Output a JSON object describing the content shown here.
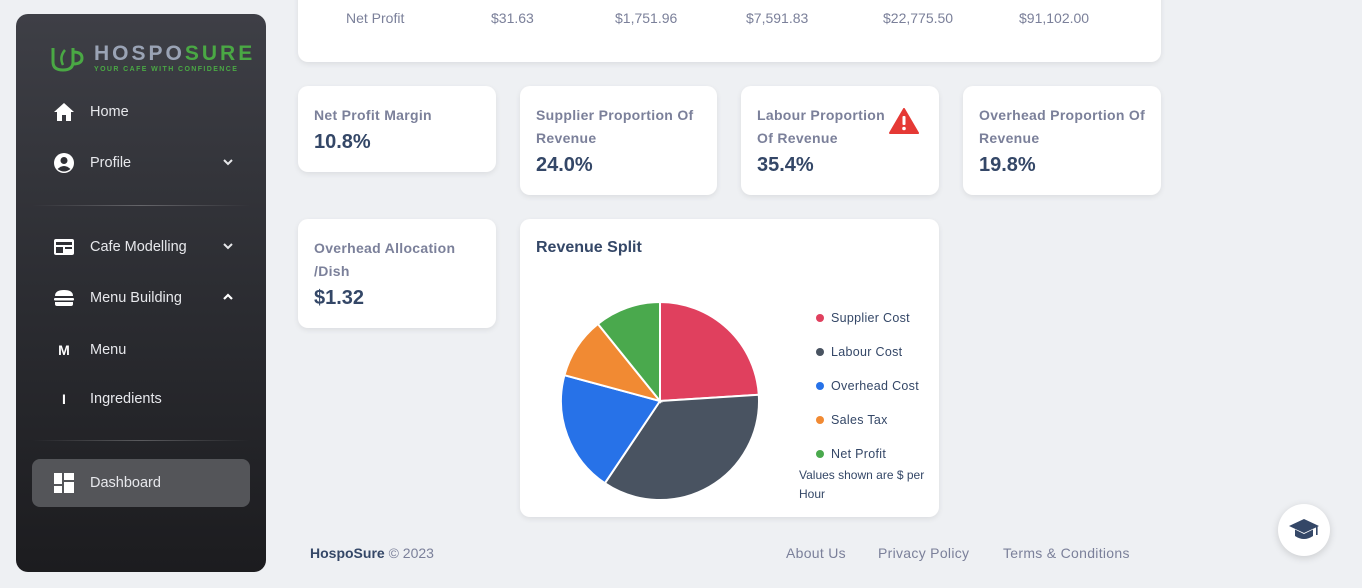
{
  "brand": {
    "name_part1": "HOSPO",
    "name_part2": "SURE",
    "tagline": "YOUR CAFE WITH CONFIDENCE"
  },
  "sidebar": {
    "items": [
      {
        "label": "Home",
        "icon": "home-icon"
      },
      {
        "label": "Profile",
        "icon": "user-circle-icon",
        "chevron": "down"
      },
      {
        "label": "Cafe Modelling",
        "icon": "storefront-icon",
        "chevron": "down"
      },
      {
        "label": "Menu Building",
        "icon": "burger-icon",
        "chevron": "up"
      },
      {
        "label": "Menu",
        "short": "M"
      },
      {
        "label": "Ingredients",
        "short": "I"
      },
      {
        "label": "Dashboard",
        "icon": "dashboard-icon",
        "active": true
      }
    ]
  },
  "net_profit_row": {
    "label": "Net Profit",
    "values": [
      "$31.63",
      "$1,751.96",
      "$7,591.83",
      "$22,775.50",
      "$91,102.00"
    ]
  },
  "stats": [
    {
      "label": "Net Profit Margin",
      "value": "10.8%"
    },
    {
      "label": "Supplier Proportion Of Revenue",
      "value": "24.0%"
    },
    {
      "label": "Labour Proportion Of Revenue",
      "value": "35.4%",
      "warning": true
    },
    {
      "label": "Overhead Proportion Of Revenue",
      "value": "19.8%"
    },
    {
      "label": "Overhead Allocation /Dish",
      "value": "$1.32"
    }
  ],
  "chart_data": {
    "type": "pie",
    "title": "Revenue Split",
    "categories": [
      "Supplier Cost",
      "Labour Cost",
      "Overhead Cost",
      "Sales Tax",
      "Net Profit"
    ],
    "values": [
      24.0,
      35.4,
      19.8,
      10.0,
      10.8
    ],
    "colors": [
      "#e0405e",
      "#495361",
      "#2772e8",
      "#f18a33",
      "#4aa94d"
    ],
    "note": "Values shown are $ per Hour",
    "legend": "right"
  },
  "footer": {
    "brand": "HospoSure",
    "copyright": "© 2023",
    "links": [
      "About Us",
      "Privacy Policy",
      "Terms & Conditions"
    ]
  },
  "help_button": {
    "icon": "graduation-cap-icon"
  }
}
